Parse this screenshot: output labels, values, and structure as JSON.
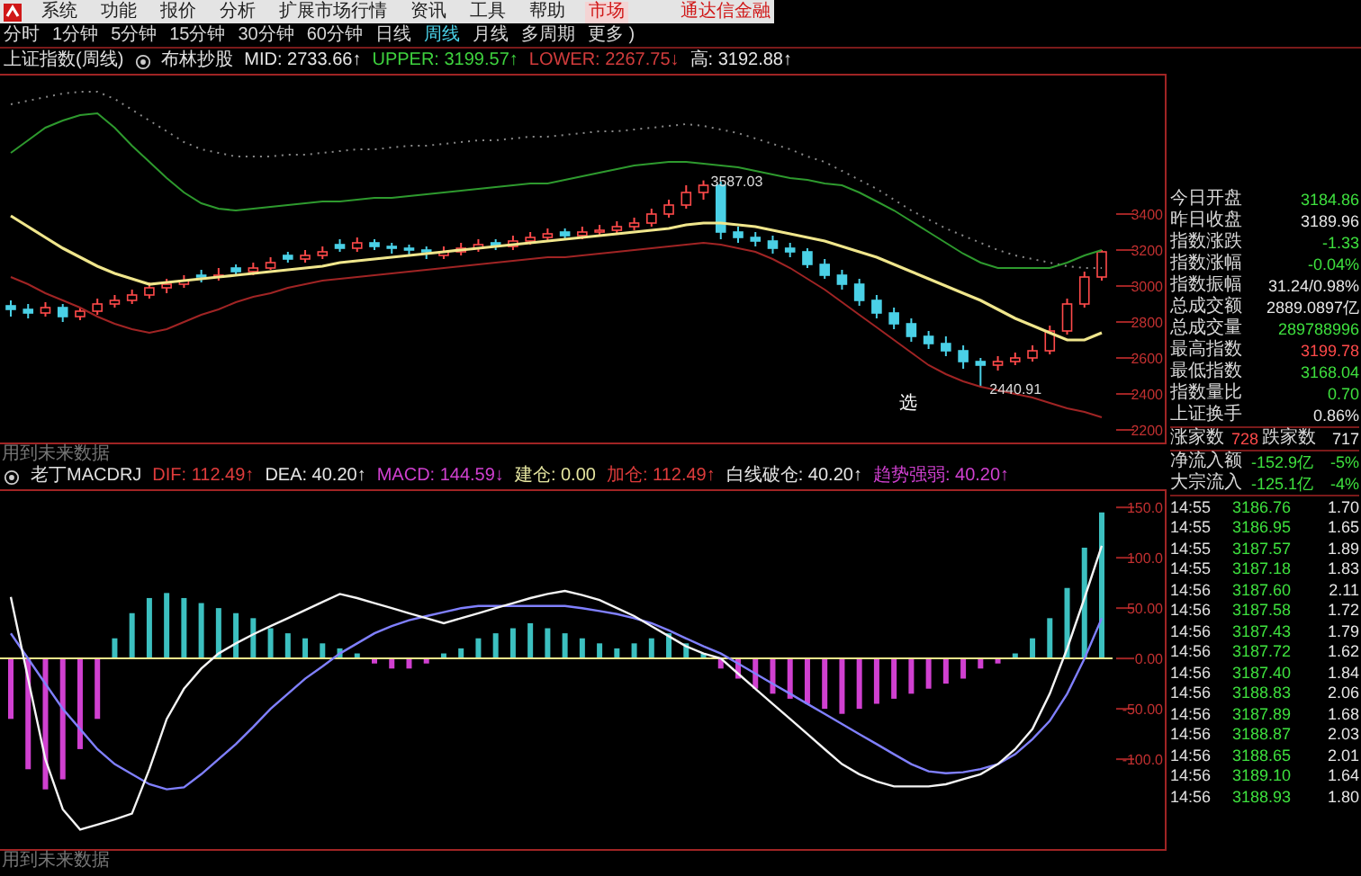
{
  "menu": {
    "items": [
      {
        "label": "系统",
        "selected": false
      },
      {
        "label": "功能",
        "selected": false
      },
      {
        "label": "报价",
        "selected": false
      },
      {
        "label": "分析",
        "selected": false
      },
      {
        "label": "扩展市场行情",
        "selected": false
      },
      {
        "label": "资讯",
        "selected": false
      },
      {
        "label": "工具",
        "selected": false
      },
      {
        "label": "帮助",
        "selected": false
      },
      {
        "label": "市场",
        "selected": true
      }
    ],
    "brand": "通达信金融"
  },
  "periods": [
    {
      "label": "分时",
      "selected": false
    },
    {
      "label": "1分钟",
      "selected": false
    },
    {
      "label": "5分钟",
      "selected": false
    },
    {
      "label": "15分钟",
      "selected": false
    },
    {
      "label": "30分钟",
      "selected": false
    },
    {
      "label": "60分钟",
      "selected": false
    },
    {
      "label": "日线",
      "selected": false
    },
    {
      "label": "周线",
      "selected": true
    },
    {
      "label": "月线",
      "selected": false
    },
    {
      "label": "多周期",
      "selected": false
    },
    {
      "label": "更多 )",
      "selected": false
    }
  ],
  "main_chart": {
    "symbol": "上证指数(周线)",
    "indicator": "布林抄股",
    "values": [
      {
        "label": "MID:",
        "value": "2733.66↑",
        "color": "#e6e6e6"
      },
      {
        "label": "UPPER:",
        "value": "3199.57↑",
        "color": "#3ed23e"
      },
      {
        "label": "LOWER:",
        "value": "2267.75↓",
        "color": "#d23c3c"
      },
      {
        "label": "高:",
        "value": "3192.88↑",
        "color": "#e6e6e6"
      }
    ],
    "high_label": "3587.03",
    "low_label": "2440.91",
    "signal_label": "选",
    "note": "用到未来数据",
    "chart_data": {
      "type": "candlestick",
      "ylim": [
        2120,
        4180
      ],
      "yticks": [
        3400,
        3200,
        3000,
        2800,
        2600,
        2400,
        2200
      ],
      "ohlc": [
        [
          2890,
          2920,
          2830,
          2870
        ],
        [
          2870,
          2900,
          2820,
          2850
        ],
        [
          2850,
          2910,
          2830,
          2880
        ],
        [
          2880,
          2900,
          2800,
          2830
        ],
        [
          2830,
          2880,
          2810,
          2860
        ],
        [
          2860,
          2930,
          2840,
          2900
        ],
        [
          2900,
          2950,
          2880,
          2920
        ],
        [
          2920,
          2980,
          2900,
          2950
        ],
        [
          2950,
          3020,
          2930,
          2990
        ],
        [
          2990,
          3040,
          2960,
          3010
        ],
        [
          3010,
          3060,
          2990,
          3030
        ],
        [
          3060,
          3090,
          3020,
          3050
        ],
        [
          3050,
          3100,
          3030,
          3060
        ],
        [
          3100,
          3120,
          3060,
          3080
        ],
        [
          3080,
          3130,
          3060,
          3100
        ],
        [
          3100,
          3160,
          3090,
          3130
        ],
        [
          3170,
          3190,
          3130,
          3150
        ],
        [
          3150,
          3200,
          3130,
          3170
        ],
        [
          3170,
          3220,
          3150,
          3190
        ],
        [
          3230,
          3260,
          3190,
          3210
        ],
        [
          3210,
          3270,
          3190,
          3240
        ],
        [
          3240,
          3260,
          3200,
          3220
        ],
        [
          3220,
          3240,
          3180,
          3210
        ],
        [
          3210,
          3230,
          3170,
          3200
        ],
        [
          3200,
          3220,
          3150,
          3190
        ],
        [
          3170,
          3220,
          3150,
          3190
        ],
        [
          3190,
          3240,
          3170,
          3210
        ],
        [
          3210,
          3260,
          3190,
          3230
        ],
        [
          3240,
          3260,
          3200,
          3220
        ],
        [
          3220,
          3280,
          3200,
          3250
        ],
        [
          3250,
          3300,
          3230,
          3270
        ],
        [
          3270,
          3320,
          3250,
          3290
        ],
        [
          3300,
          3320,
          3260,
          3280
        ],
        [
          3280,
          3330,
          3260,
          3300
        ],
        [
          3300,
          3340,
          3280,
          3310
        ],
        [
          3310,
          3360,
          3290,
          3330
        ],
        [
          3330,
          3380,
          3310,
          3350
        ],
        [
          3350,
          3430,
          3330,
          3400
        ],
        [
          3400,
          3480,
          3380,
          3450
        ],
        [
          3450,
          3560,
          3430,
          3520
        ],
        [
          3520,
          3587,
          3480,
          3560
        ],
        [
          3560,
          3580,
          3260,
          3300
        ],
        [
          3300,
          3330,
          3240,
          3270
        ],
        [
          3270,
          3300,
          3220,
          3250
        ],
        [
          3250,
          3280,
          3180,
          3210
        ],
        [
          3210,
          3240,
          3160,
          3190
        ],
        [
          3190,
          3210,
          3100,
          3120
        ],
        [
          3120,
          3150,
          3040,
          3060
        ],
        [
          3060,
          3090,
          2980,
          3010
        ],
        [
          3010,
          3040,
          2890,
          2920
        ],
        [
          2920,
          2950,
          2820,
          2850
        ],
        [
          2850,
          2880,
          2760,
          2790
        ],
        [
          2790,
          2820,
          2690,
          2720
        ],
        [
          2720,
          2750,
          2650,
          2680
        ],
        [
          2680,
          2720,
          2610,
          2640
        ],
        [
          2640,
          2670,
          2540,
          2580
        ],
        [
          2580,
          2600,
          2441,
          2560
        ],
        [
          2560,
          2610,
          2530,
          2580
        ],
        [
          2580,
          2630,
          2560,
          2600
        ],
        [
          2600,
          2670,
          2580,
          2640
        ],
        [
          2640,
          2780,
          2620,
          2750
        ],
        [
          2750,
          2930,
          2730,
          2900
        ],
        [
          2900,
          3080,
          2880,
          3050
        ],
        [
          3050,
          3200,
          3030,
          3190
        ]
      ],
      "series": [
        {
          "type": "line",
          "color": "#888888",
          "line_style": "dotted",
          "values": [
            4010,
            4030,
            4050,
            4070,
            4080,
            4080,
            4040,
            3980,
            3920,
            3860,
            3800,
            3760,
            3740,
            3720,
            3720,
            3720,
            3730,
            3730,
            3740,
            3750,
            3760,
            3760,
            3770,
            3780,
            3780,
            3790,
            3800,
            3810,
            3810,
            3820,
            3830,
            3830,
            3840,
            3850,
            3860,
            3860,
            3870,
            3880,
            3890,
            3900,
            3890,
            3870,
            3850,
            3820,
            3790,
            3760,
            3720,
            3690,
            3640,
            3590,
            3540,
            3480,
            3420,
            3370,
            3320,
            3280,
            3240,
            3200,
            3170,
            3150,
            3130,
            3110,
            3100,
            3100
          ]
        },
        {
          "type": "line",
          "color": "#2e9a2e",
          "line_style": "solid",
          "values": [
            3740,
            3810,
            3880,
            3920,
            3950,
            3960,
            3880,
            3780,
            3690,
            3600,
            3520,
            3460,
            3430,
            3420,
            3430,
            3440,
            3450,
            3460,
            3470,
            3470,
            3480,
            3490,
            3490,
            3500,
            3510,
            3520,
            3530,
            3540,
            3550,
            3560,
            3570,
            3570,
            3590,
            3610,
            3630,
            3650,
            3670,
            3680,
            3690,
            3690,
            3680,
            3670,
            3660,
            3640,
            3620,
            3600,
            3590,
            3570,
            3560,
            3520,
            3470,
            3420,
            3360,
            3300,
            3240,
            3180,
            3130,
            3100,
            3100,
            3100,
            3100,
            3130,
            3170,
            3200
          ]
        },
        {
          "type": "line",
          "color": "#a02424",
          "line_style": "solid",
          "values": [
            3050,
            3010,
            2960,
            2920,
            2880,
            2830,
            2790,
            2760,
            2740,
            2760,
            2800,
            2840,
            2870,
            2910,
            2940,
            2960,
            2990,
            3010,
            3030,
            3040,
            3050,
            3060,
            3070,
            3080,
            3090,
            3100,
            3110,
            3120,
            3130,
            3140,
            3150,
            3160,
            3160,
            3170,
            3180,
            3190,
            3200,
            3210,
            3220,
            3230,
            3240,
            3230,
            3210,
            3190,
            3150,
            3100,
            3040,
            2980,
            2910,
            2840,
            2770,
            2700,
            2630,
            2560,
            2510,
            2470,
            2440,
            2420,
            2400,
            2380,
            2350,
            2320,
            2300,
            2270
          ]
        },
        {
          "type": "line",
          "color": "#f0e68c",
          "line_style": "solid",
          "values": [
            3390,
            3330,
            3270,
            3210,
            3160,
            3110,
            3070,
            3040,
            3010,
            3020,
            3030,
            3040,
            3050,
            3060,
            3070,
            3080,
            3090,
            3100,
            3110,
            3130,
            3140,
            3150,
            3160,
            3170,
            3180,
            3190,
            3200,
            3210,
            3220,
            3230,
            3240,
            3250,
            3260,
            3270,
            3280,
            3290,
            3300,
            3310,
            3320,
            3340,
            3350,
            3350,
            3340,
            3330,
            3310,
            3290,
            3270,
            3250,
            3220,
            3190,
            3160,
            3120,
            3080,
            3040,
            3000,
            2960,
            2920,
            2870,
            2820,
            2780,
            2740,
            2700,
            2700,
            2740
          ]
        }
      ]
    }
  },
  "macd_panel": {
    "indicator": "老丁MACDRJ",
    "values": [
      {
        "label": "DIF:",
        "value": "112.49↑",
        "color": "#e03c3c"
      },
      {
        "label": "DEA:",
        "value": "40.20↑",
        "color": "#e6e6e6"
      },
      {
        "label": "MACD:",
        "value": "144.59↓",
        "color": "#d040d0"
      },
      {
        "label": "建仓:",
        "value": "0.00",
        "color": "#e6e6a0"
      },
      {
        "label": "加仓:",
        "value": "112.49↑",
        "color": "#e03c3c"
      },
      {
        "label": "白线破仓:",
        "value": "40.20↑",
        "color": "#e6e6e6"
      },
      {
        "label": "趋势强弱:",
        "value": "40.20↑",
        "color": "#d040d0"
      }
    ],
    "note": "用到未来数据",
    "chart_data": {
      "type": "bar",
      "stacked": true,
      "ylim": [
        -191,
        168
      ],
      "yticks": [
        {
          "value": 150,
          "label": "150.0"
        },
        {
          "value": 100,
          "label": "100.0"
        },
        {
          "value": 50,
          "label": "50.00"
        },
        {
          "value": 0,
          "label": "0.00"
        },
        {
          "value": -50,
          "label": "-50.00"
        },
        {
          "value": -100,
          "label": "-100.0"
        }
      ],
      "ref_lines": [
        {
          "axis": "y",
          "value": 0
        }
      ],
      "series": [
        {
          "type": "bar",
          "color": "#3cc0c0",
          "values": [
            null,
            null,
            null,
            null,
            null,
            null,
            20,
            45,
            60,
            65,
            60,
            55,
            50,
            45,
            40,
            30,
            25,
            20,
            15,
            10,
            5,
            null,
            null,
            null,
            null,
            5,
            10,
            20,
            25,
            30,
            35,
            30,
            25,
            20,
            15,
            10,
            15,
            20,
            25,
            15,
            5,
            null,
            null,
            null,
            null,
            null,
            null,
            null,
            null,
            null,
            null,
            null,
            null,
            null,
            null,
            null,
            null,
            null,
            5,
            20,
            40,
            70,
            110,
            145
          ]
        },
        {
          "type": "bar",
          "color": "#d040d0",
          "values": [
            -60,
            -110,
            -130,
            -120,
            -90,
            -60,
            null,
            null,
            null,
            null,
            null,
            null,
            null,
            null,
            null,
            null,
            null,
            null,
            null,
            null,
            null,
            -5,
            -10,
            -10,
            -5,
            null,
            null,
            null,
            null,
            null,
            null,
            null,
            null,
            null,
            null,
            null,
            null,
            null,
            null,
            null,
            null,
            -10,
            -20,
            -30,
            -35,
            -40,
            -45,
            -50,
            -55,
            -50,
            -45,
            -40,
            -35,
            -30,
            -25,
            -20,
            -10,
            -5,
            null,
            null,
            null,
            null,
            null,
            null
          ]
        },
        {
          "type": "line",
          "color": "#8080ff",
          "values": [
            25,
            0,
            -25,
            -50,
            -70,
            -90,
            -105,
            -115,
            -125,
            -130,
            -128,
            -115,
            -100,
            -85,
            -68,
            -50,
            -35,
            -20,
            -8,
            5,
            15,
            25,
            32,
            38,
            42,
            46,
            50,
            52,
            52,
            52,
            52,
            52,
            52,
            50,
            47,
            44,
            40,
            35,
            28,
            20,
            12,
            5,
            -5,
            -15,
            -25,
            -35,
            -45,
            -55,
            -65,
            -75,
            -85,
            -95,
            -105,
            -112,
            -114,
            -113,
            -110,
            -105,
            -95,
            -80,
            -62,
            -35,
            0,
            40
          ]
        },
        {
          "type": "line",
          "color": "#f4f4f4",
          "values": [
            61,
            -20,
            -100,
            -150,
            -170,
            -165,
            -160,
            -154,
            -110,
            -60,
            -30,
            -10,
            5,
            15,
            24,
            32,
            40,
            48,
            56,
            64,
            60,
            55,
            50,
            45,
            40,
            35,
            40,
            45,
            50,
            55,
            60,
            64,
            67,
            63,
            58,
            50,
            42,
            32,
            22,
            12,
            5,
            0,
            -15,
            -30,
            -45,
            -60,
            -75,
            -90,
            -105,
            -115,
            -122,
            -127,
            -127,
            -127,
            -125,
            -120,
            -115,
            -105,
            -90,
            -70,
            -35,
            10,
            60,
            112
          ]
        }
      ]
    }
  },
  "quote_panel": {
    "stats": [
      {
        "label": "今日开盘",
        "value": "3184.86",
        "color": "#3ee03e"
      },
      {
        "label": "昨日收盘",
        "value": "3189.96",
        "color": "#e6e6e6"
      },
      {
        "label": "指数涨跌",
        "value": "-1.33",
        "color": "#3ee03e"
      },
      {
        "label": "指数涨幅",
        "value": "-0.04%",
        "color": "#3ee03e"
      },
      {
        "label": "指数振幅",
        "value": "31.24/0.98%",
        "color": "#e6e6e6"
      },
      {
        "label": "总成交额",
        "value": "2889.0897亿",
        "color": "#e6e6e6"
      },
      {
        "label": "总成交量",
        "value": "289788996",
        "color": "#3ee03e"
      },
      {
        "label": "最高指数",
        "value": "3199.78",
        "color": "#ff4a4a"
      },
      {
        "label": "最低指数",
        "value": "3168.04",
        "color": "#3ee03e"
      },
      {
        "label": "指数量比",
        "value": "0.70",
        "color": "#3ee03e"
      },
      {
        "label": "上证换手",
        "value": "0.86%",
        "color": "#e6e6e6"
      }
    ],
    "breadth": {
      "rise_label": "涨家数",
      "rise_count": "728",
      "fall_label": "跌家数",
      "fall_count": "717"
    },
    "flows": [
      {
        "label": "净流入额",
        "value": "-152.9亿",
        "pct": "-5%"
      },
      {
        "label": "大宗流入",
        "value": "-125.1亿",
        "pct": "-4%"
      }
    ],
    "ticks": [
      {
        "time": "14:55",
        "price": "3186.76",
        "volume": "1.70"
      },
      {
        "time": "14:55",
        "price": "3186.95",
        "volume": "1.65"
      },
      {
        "time": "14:55",
        "price": "3187.57",
        "volume": "1.89"
      },
      {
        "time": "14:55",
        "price": "3187.18",
        "volume": "1.83"
      },
      {
        "time": "14:56",
        "price": "3187.60",
        "volume": "2.11"
      },
      {
        "time": "14:56",
        "price": "3187.58",
        "volume": "1.72"
      },
      {
        "time": "14:56",
        "price": "3187.43",
        "volume": "1.79"
      },
      {
        "time": "14:56",
        "price": "3187.72",
        "volume": "1.62"
      },
      {
        "time": "14:56",
        "price": "3187.40",
        "volume": "1.84"
      },
      {
        "time": "14:56",
        "price": "3188.83",
        "volume": "2.06"
      },
      {
        "time": "14:56",
        "price": "3187.89",
        "volume": "1.68"
      },
      {
        "time": "14:56",
        "price": "3188.87",
        "volume": "2.03"
      },
      {
        "time": "14:56",
        "price": "3188.65",
        "volume": "2.01"
      },
      {
        "time": "14:56",
        "price": "3189.10",
        "volume": "1.64"
      },
      {
        "time": "14:56",
        "price": "3188.93",
        "volume": "1.80"
      }
    ]
  }
}
